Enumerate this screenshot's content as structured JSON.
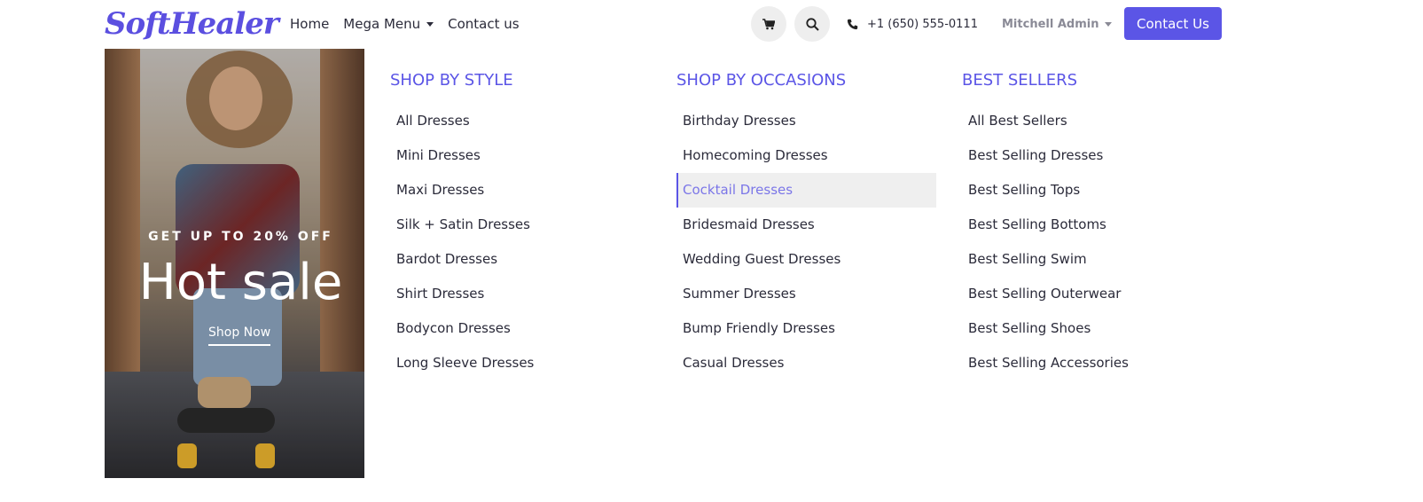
{
  "header": {
    "logo": "SoftHealer",
    "nav": [
      {
        "label": "Home"
      },
      {
        "label": "Mega Menu"
      },
      {
        "label": "Contact us"
      }
    ],
    "phone": "+1 (650) 555-0111",
    "user": "Mitchell Admin",
    "contact_button": "Contact Us"
  },
  "promo": {
    "subtitle": "GET UP TO 20% OFF",
    "title": "Hot sale",
    "link": "Shop Now"
  },
  "columns": [
    {
      "title": "SHOP BY STYLE",
      "items": [
        "All Dresses",
        "Mini Dresses",
        "Maxi Dresses",
        "Silk + Satin Dresses",
        "Bardot Dresses",
        "Shirt Dresses",
        "Bodycon Dresses",
        "Long Sleeve Dresses"
      ]
    },
    {
      "title": "SHOP BY OCCASIONS",
      "items": [
        "Birthday Dresses",
        "Homecoming Dresses",
        "Cocktail Dresses",
        "Bridesmaid Dresses",
        "Wedding Guest Dresses",
        "Summer Dresses",
        "Bump Friendly Dresses",
        "Casual Dresses"
      ]
    },
    {
      "title": "BEST SELLERS",
      "items": [
        "All Best Sellers",
        "Best Selling Dresses",
        "Best Selling Tops",
        "Best Selling Bottoms",
        "Best Selling Swim",
        "Best Selling Outerwear",
        "Best Selling Shoes",
        "Best Selling Accessories"
      ]
    }
  ],
  "colors": {
    "accent": "#5b55e6",
    "active_text": "#7b76e8",
    "active_bg": "#efefef"
  },
  "icons": {
    "cart": "cart-icon",
    "search": "search-icon",
    "phone": "phone-icon"
  }
}
